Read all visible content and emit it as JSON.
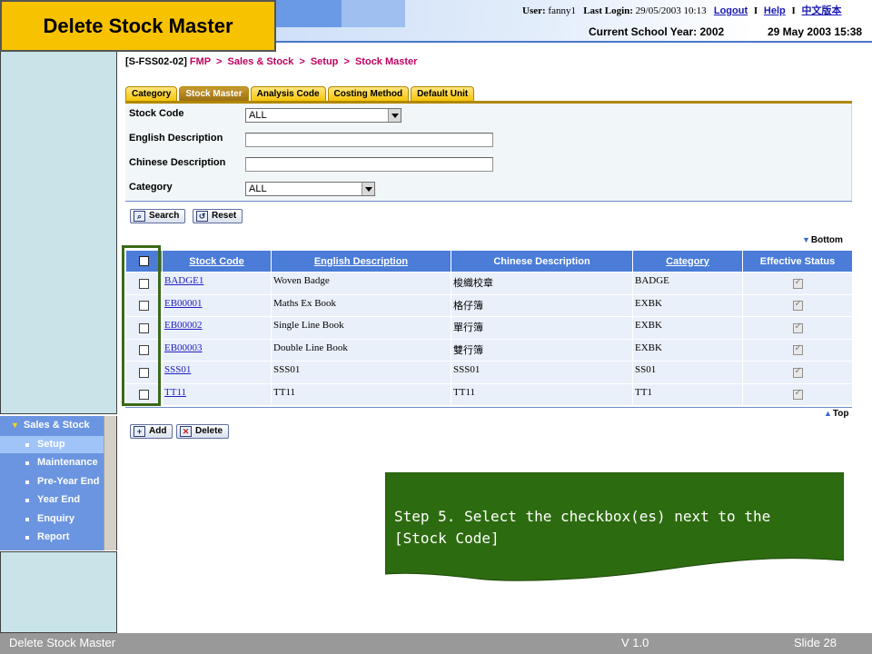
{
  "slide": {
    "title": "Delete Stock Master",
    "callout": "Step 5. Select the checkbox(es) next to the [Stock Code]",
    "footer_left": "Delete Stock Master",
    "footer_version": "V 1.0",
    "footer_slide": "Slide 28",
    "highlight_color": "#3a6a18",
    "callout_color": "#2d6b10",
    "title_bg": "#f7c200"
  },
  "header": {
    "user_label": "User:",
    "user_name": "fanny1",
    "last_login_label": "Last Login:",
    "last_login": "29/05/2003 10:13",
    "logout": "Logout",
    "help": "Help",
    "chinese_version": "中文版本",
    "school_year": "Current School Year: 2002",
    "date_time": "29 May 2003 15:38",
    "separator": "I"
  },
  "breadcrumb": {
    "code": "[S-FSS02-02]",
    "items": [
      "FMP",
      "Sales & Stock",
      "Setup",
      "Stock Master"
    ],
    "separator": ">"
  },
  "tabs": [
    {
      "label": "Category",
      "active": false
    },
    {
      "label": "Stock Master",
      "active": true
    },
    {
      "label": "Analysis Code",
      "active": false
    },
    {
      "label": "Costing Method",
      "active": false
    },
    {
      "label": "Default Unit",
      "active": false
    }
  ],
  "form": {
    "stock_code_label": "Stock Code",
    "stock_code_value": "ALL",
    "english_desc_label": "English Description",
    "english_desc_value": "",
    "chinese_desc_label": "Chinese Description",
    "chinese_desc_value": "",
    "category_label": "Category",
    "category_value": "ALL",
    "search_button": "Search",
    "reset_button": "Reset"
  },
  "jump": {
    "bottom": "Bottom",
    "top": "Top"
  },
  "table": {
    "headers": [
      "Stock Code",
      "English Description",
      "Chinese Description",
      "Category",
      "Effective Status"
    ],
    "rows": [
      {
        "code": "BADGE1",
        "english": "Woven Badge",
        "chinese": "梭織校章",
        "category": "BADGE",
        "effective": true
      },
      {
        "code": "EB00001",
        "english": "Maths Ex Book",
        "chinese": "格仔簿",
        "category": "EXBK",
        "effective": true
      },
      {
        "code": "EB00002",
        "english": "Single Line Book",
        "chinese": "單行簿",
        "category": "EXBK",
        "effective": true
      },
      {
        "code": "EB00003",
        "english": "Double Line Book",
        "chinese": "雙行簿",
        "category": "EXBK",
        "effective": true
      },
      {
        "code": "SSS01",
        "english": "SSS01",
        "chinese": "SSS01",
        "category": "SS01",
        "effective": true
      },
      {
        "code": "TT11",
        "english": "TT11",
        "chinese": "TT11",
        "category": "TT1",
        "effective": true
      }
    ]
  },
  "actions": {
    "add_button": "Add",
    "delete_button": "Delete"
  },
  "nav": {
    "section": "Sales & Stock",
    "items": [
      {
        "label": "Setup",
        "active": true
      },
      {
        "label": "Maintenance",
        "active": false
      },
      {
        "label": "Pre-Year End",
        "active": false
      },
      {
        "label": "Year End",
        "active": false
      },
      {
        "label": "Enquiry",
        "active": false
      },
      {
        "label": "Report",
        "active": false
      }
    ]
  }
}
